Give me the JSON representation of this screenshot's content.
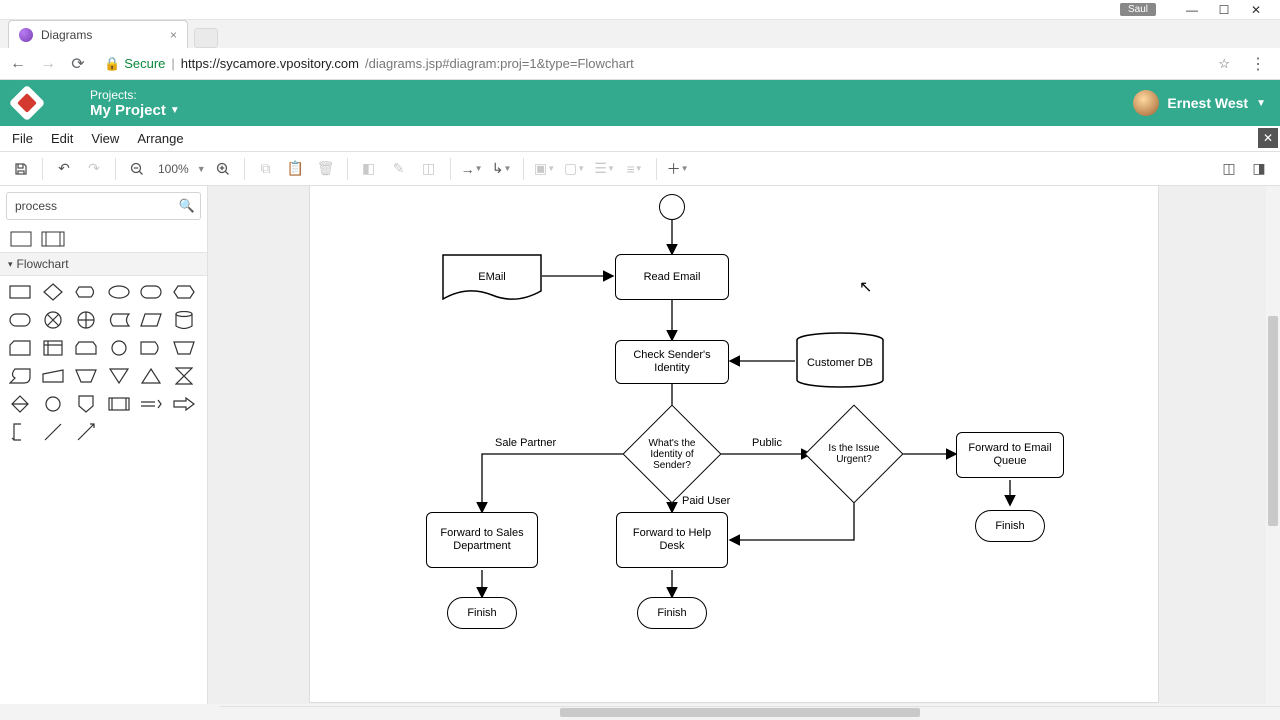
{
  "os": {
    "user_badge": "Saul"
  },
  "browser": {
    "tab_title": "Diagrams",
    "secure_label": "Secure",
    "url_host": "https://sycamore.vpository.com",
    "url_path": "/diagrams.jsp#diagram:proj=1&type=Flowchart"
  },
  "header": {
    "projects_label": "Projects:",
    "project_name": "My Project",
    "user_name": "Ernest West"
  },
  "menubar": {
    "file": "File",
    "edit": "Edit",
    "view": "View",
    "arrange": "Arrange"
  },
  "toolbar": {
    "zoom_level": "100%"
  },
  "sidebar": {
    "search_value": "process",
    "category_label": "Flowchart"
  },
  "diagram": {
    "nodes": {
      "start": "",
      "email_doc": "EMail",
      "read_email": "Read Email",
      "check_identity": "Check Sender's Identity",
      "customer_db": "Customer DB",
      "decision_identity": "What's the Identity of Sender?",
      "decision_urgent": "Is the Issue Urgent?",
      "fwd_email_queue": "Forward to Email Queue",
      "fwd_help_desk": "Forward to Help Desk",
      "fwd_sales": "Forward to Sales Department",
      "finish1": "Finish",
      "finish2": "Finish",
      "finish3": "Finish"
    },
    "edge_labels": {
      "sale_partner": "Sale Partner",
      "public": "Public",
      "paid_user": "Paid User"
    }
  }
}
